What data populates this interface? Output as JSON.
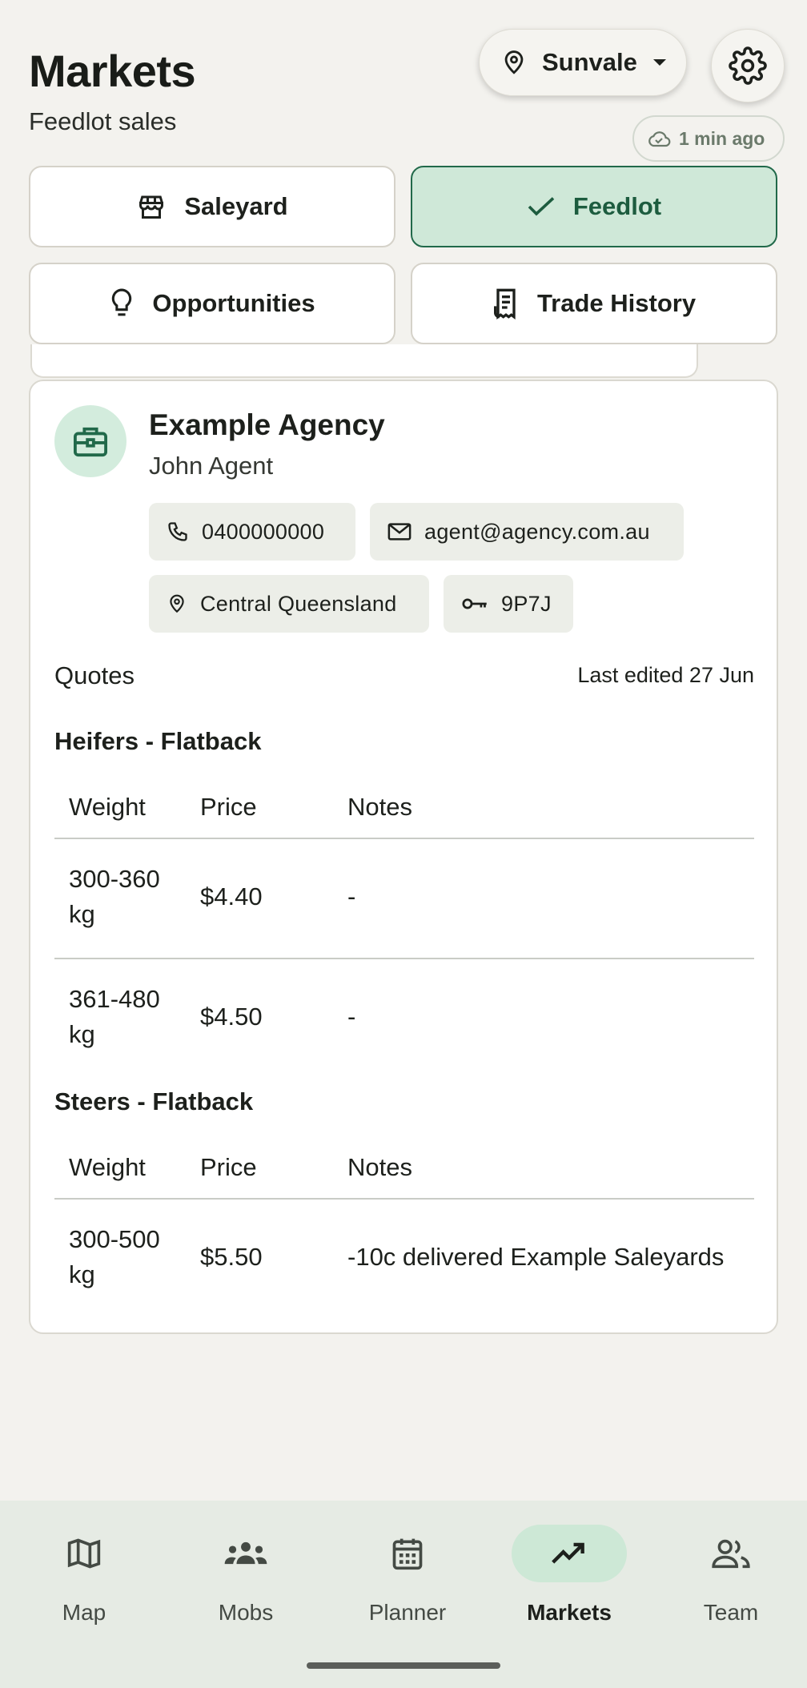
{
  "header": {
    "title": "Markets",
    "subtitle": "Feedlot sales",
    "location": "Sunvale",
    "sync_status": "1 min ago"
  },
  "tabs": [
    {
      "label": "Saleyard",
      "icon": "storefront-icon",
      "active": false
    },
    {
      "label": "Feedlot",
      "icon": "check-icon",
      "active": true
    },
    {
      "label": "Opportunities",
      "icon": "lightbulb-icon",
      "active": false
    },
    {
      "label": "Trade History",
      "icon": "receipt-icon",
      "active": false
    }
  ],
  "agent_card": {
    "agency": "Example Agency",
    "agent": "John Agent",
    "phone": "0400000000",
    "email": "agent@agency.com.au",
    "region": "Central Queensland",
    "code": "9P7J",
    "quotes_label": "Quotes",
    "last_edited": "Last edited 27 Jun",
    "sections": [
      {
        "title": "Heifers - Flatback",
        "headers": [
          "Weight",
          "Price",
          "Notes"
        ],
        "rows": [
          {
            "weight": "300-360 kg",
            "price": "$4.40",
            "notes": "-"
          },
          {
            "weight": "361-480 kg",
            "price": "$4.50",
            "notes": "-"
          }
        ]
      },
      {
        "title": "Steers - Flatback",
        "headers": [
          "Weight",
          "Price",
          "Notes"
        ],
        "rows": [
          {
            "weight": "300-500 kg",
            "price": "$5.50",
            "notes": "-10c delivered Example Saleyards"
          }
        ]
      }
    ]
  },
  "bottom_nav": [
    {
      "label": "Map",
      "icon": "map-icon",
      "active": false
    },
    {
      "label": "Mobs",
      "icon": "mobs-icon",
      "active": false
    },
    {
      "label": "Planner",
      "icon": "calendar-icon",
      "active": false
    },
    {
      "label": "Markets",
      "icon": "trending-up-icon",
      "active": true
    },
    {
      "label": "Team",
      "icon": "team-icon",
      "active": false
    }
  ],
  "colors": {
    "accent": "#21694a",
    "accent_bg": "#cfe8d8",
    "background": "#f3f2ee"
  }
}
